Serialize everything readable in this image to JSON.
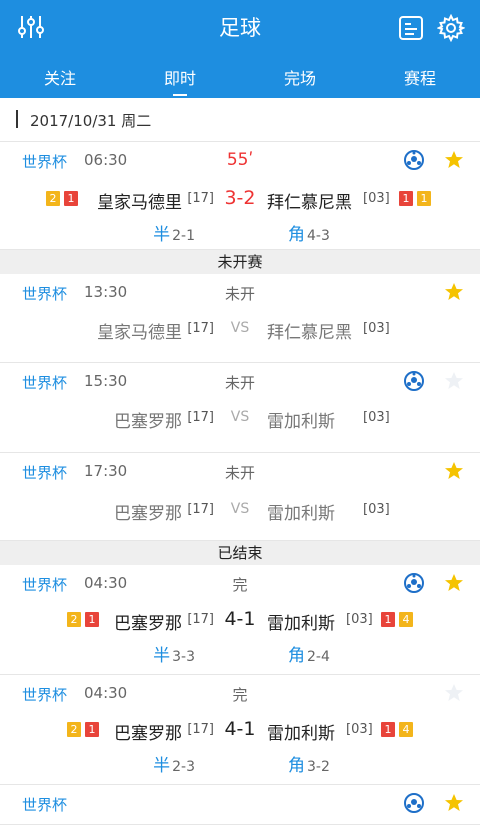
{
  "app": {
    "title": "足球",
    "icons": {
      "filter": "filter-sliders-icon",
      "list": "list-icon",
      "settings": "gear-icon"
    }
  },
  "tabs": [
    {
      "label": "关注",
      "active": false
    },
    {
      "label": "即时",
      "active": true
    },
    {
      "label": "完场",
      "active": false
    },
    {
      "label": "赛程",
      "active": false
    }
  ],
  "date": "2017/10/31  周二",
  "sections": {
    "upcoming": "未开赛",
    "finished": "已结束"
  },
  "matches": [
    {
      "league": "世界杯",
      "time": "06:30",
      "status": "55ʹ",
      "home": "皇家马德里",
      "home_rank": "[17]",
      "away": "拜仁慕尼黑",
      "away_rank": "[03]",
      "score": "3-2",
      "home_cards": [
        "2",
        "1"
      ],
      "away_cards": [
        "1",
        "1"
      ],
      "half_label": "半",
      "half": "2-1",
      "corner_label": "角",
      "corner": "4-3",
      "ball": true,
      "starred": true
    },
    {
      "league": "世界杯",
      "time": "13:30",
      "status": "未开",
      "home": "皇家马德里",
      "home_rank": "[17]",
      "vs": "VS",
      "away": "拜仁慕尼黑",
      "away_rank": "[03]",
      "ball": false,
      "starred": true
    },
    {
      "league": "世界杯",
      "time": "15:30",
      "status": "未开",
      "home": "巴塞罗那",
      "home_rank": "[17]",
      "vs": "VS",
      "away": "雷加利斯",
      "away_rank": "[03]",
      "ball": true,
      "starred": false
    },
    {
      "league": "世界杯",
      "time": "17:30",
      "status": "未开",
      "home": "巴塞罗那",
      "home_rank": "[17]",
      "vs": "VS",
      "away": "雷加利斯",
      "away_rank": "[03]",
      "ball": false,
      "starred": true
    },
    {
      "league": "世界杯",
      "time": "04:30",
      "status": "完",
      "home": "巴塞罗那",
      "home_rank": "[17]",
      "away": "雷加利斯",
      "away_rank": "[03]",
      "score": "4-1",
      "home_cards": [
        "2",
        "1"
      ],
      "away_cards": [
        "1",
        "4"
      ],
      "half_label": "半",
      "half": "3-3",
      "corner_label": "角",
      "corner": "2-4",
      "ball": true,
      "starred": true
    },
    {
      "league": "世界杯",
      "time": "04:30",
      "status": "完",
      "home": "巴塞罗那",
      "home_rank": "[17]",
      "away": "雷加利斯",
      "away_rank": "[03]",
      "score": "4-1",
      "home_cards": [
        "2",
        "1"
      ],
      "away_cards": [
        "1",
        "4"
      ],
      "half_label": "半",
      "half": "2-3",
      "corner_label": "角",
      "corner": "3-2",
      "ball": false,
      "starred": false
    },
    {
      "league": "世界杯"
    }
  ],
  "colors": {
    "accent": "#1e8ee0",
    "live": "#e33333",
    "yellow_card": "#f3b51b",
    "red_card": "#e8443a",
    "star": "#f5c300"
  }
}
